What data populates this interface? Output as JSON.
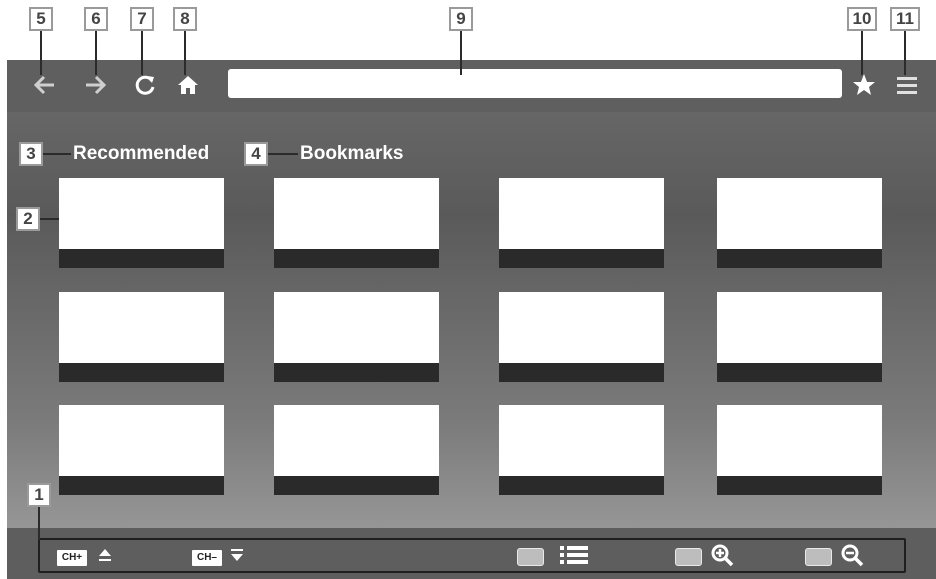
{
  "callouts": {
    "c1": "1",
    "c2": "2",
    "c3": "3",
    "c4": "4",
    "c5": "5",
    "c6": "6",
    "c7": "7",
    "c8": "8",
    "c9": "9",
    "c10": "10",
    "c11": "11"
  },
  "toolbar": {
    "back_icon": "back-arrow-icon",
    "forward_icon": "forward-arrow-icon",
    "reload_icon": "reload-icon",
    "home_icon": "home-icon",
    "bookmark_icon": "star-icon",
    "menu_icon": "hamburger-menu-icon",
    "url_value": ""
  },
  "sections": {
    "recommended_label": "Recommended",
    "bookmarks_label": "Bookmarks"
  },
  "bottom_bar": {
    "ch_up_label": "CH+",
    "ch_down_label": "CH–",
    "list_icon": "list-icon",
    "zoom_in_icon": "zoom-in-icon",
    "zoom_out_icon": "zoom-out-icon"
  },
  "colors": {
    "panel": "#5f5f5f",
    "tile": "#ffffff",
    "tile_strip": "#2a2a2a",
    "icon": "#d6d6d6"
  }
}
